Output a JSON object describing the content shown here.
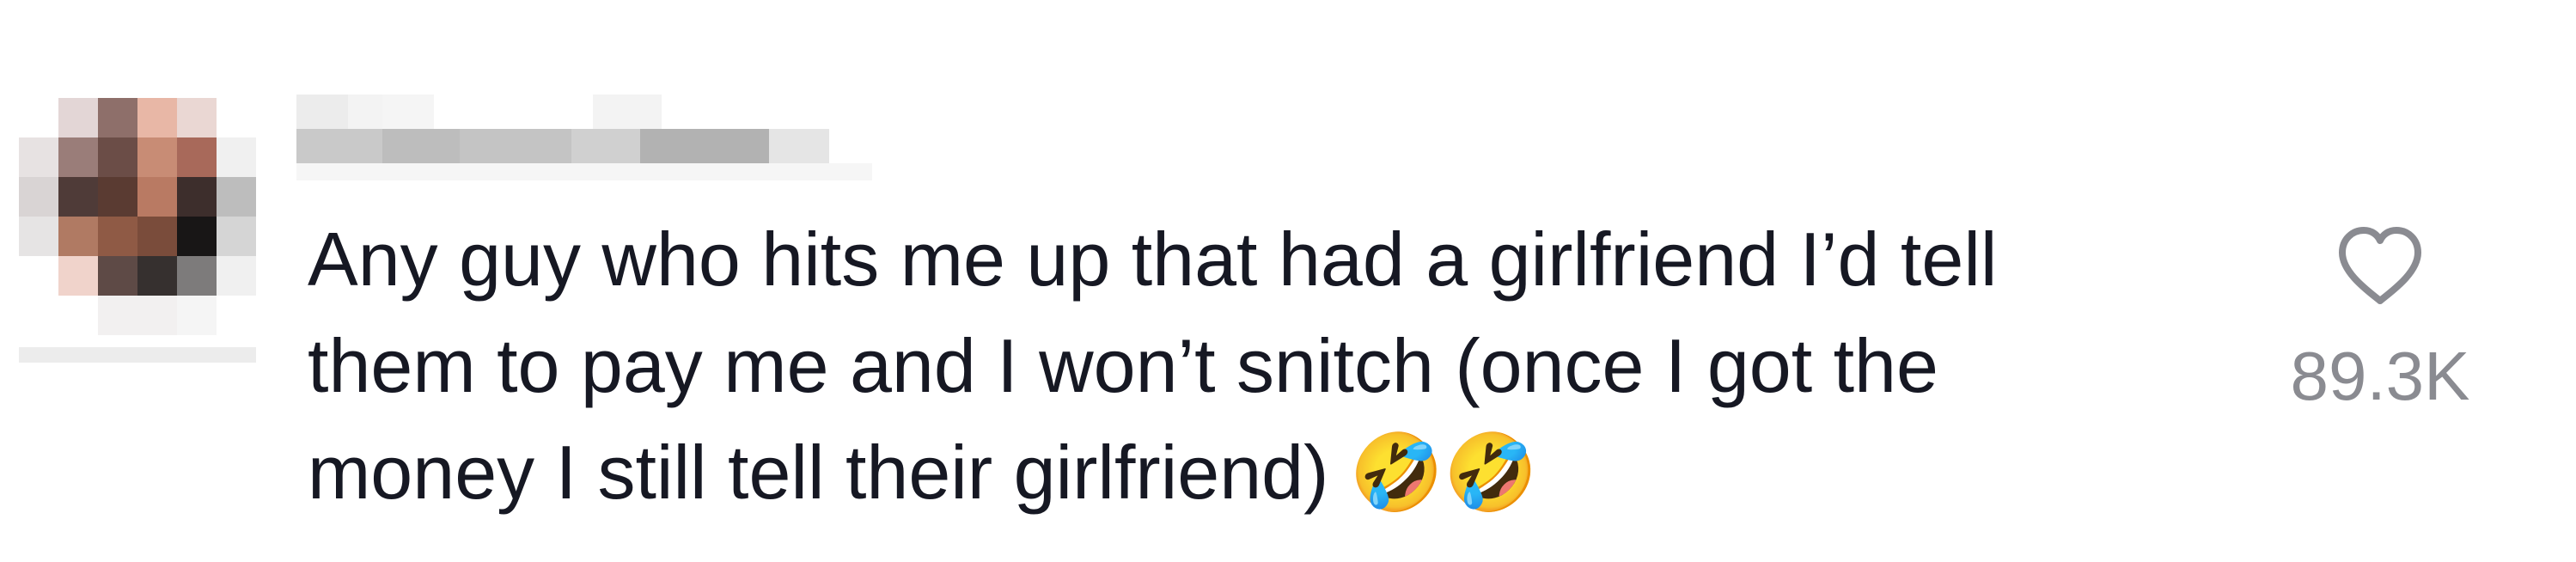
{
  "comment": {
    "text_line_1": "Any guy who hits me up that had a girlfriend I’d tell",
    "text_line_2": "them to pay me and I won’t snitch (once I got the",
    "text_line_3": "money I still tell their girlfriend) ",
    "emoji": "🤣🤣",
    "like_count": "89.3K"
  },
  "icons": {
    "like": "heart-outline-icon",
    "avatar": "pixelated-avatar",
    "username": "pixelated-username"
  },
  "colors": {
    "text": "#161823",
    "like_count": "#8a8b91",
    "heart_stroke": "#8a8b91",
    "background": "#ffffff"
  }
}
